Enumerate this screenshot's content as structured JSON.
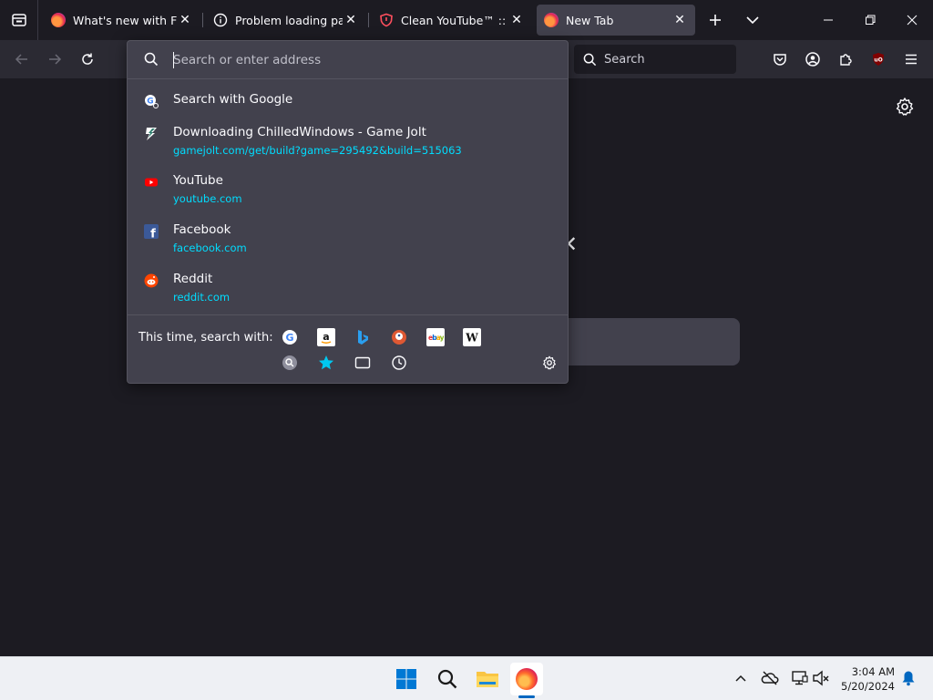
{
  "tabs": [
    {
      "title": "What's new with Firefox",
      "icon": "firefox-icon",
      "active": false
    },
    {
      "title": "Problem loading page",
      "icon": "info-icon",
      "active": false
    },
    {
      "title": "Clean YouTube™ :: MyS",
      "icon": "shield-icon",
      "active": false
    },
    {
      "title": "New Tab",
      "icon": "firefox-icon",
      "active": true
    }
  ],
  "toolbar": {
    "search_label": "Search"
  },
  "urlbar": {
    "placeholder": "Search or enter address",
    "value": ""
  },
  "results": [
    {
      "title": "Search with Google",
      "url": "",
      "icon": "google-search-icon"
    },
    {
      "title": "Downloading ChilledWindows - Game Jolt",
      "url": "gamejolt.com/get/build?game=295492&build=515063",
      "icon": "gamejolt-icon"
    },
    {
      "title": "YouTube",
      "url": "youtube.com",
      "icon": "youtube-icon"
    },
    {
      "title": "Facebook",
      "url": "facebook.com",
      "icon": "facebook-icon"
    },
    {
      "title": "Reddit",
      "url": "reddit.com",
      "icon": "reddit-icon"
    }
  ],
  "oneoff": {
    "label": "This time, search with:",
    "engines": [
      "Google",
      "Amazon",
      "Bing",
      "DuckDuckGo",
      "eBay",
      "Wikipedia"
    ],
    "modes": [
      "Search extension",
      "Bookmarks",
      "Tabs",
      "History"
    ]
  },
  "taskbar": {
    "time": "3:04 AM",
    "date": "5/20/2024"
  },
  "colors": {
    "accent": "#00ddff",
    "panel": "#42414d",
    "background": "#1c1b22",
    "taskbar": "#eef0f4"
  }
}
